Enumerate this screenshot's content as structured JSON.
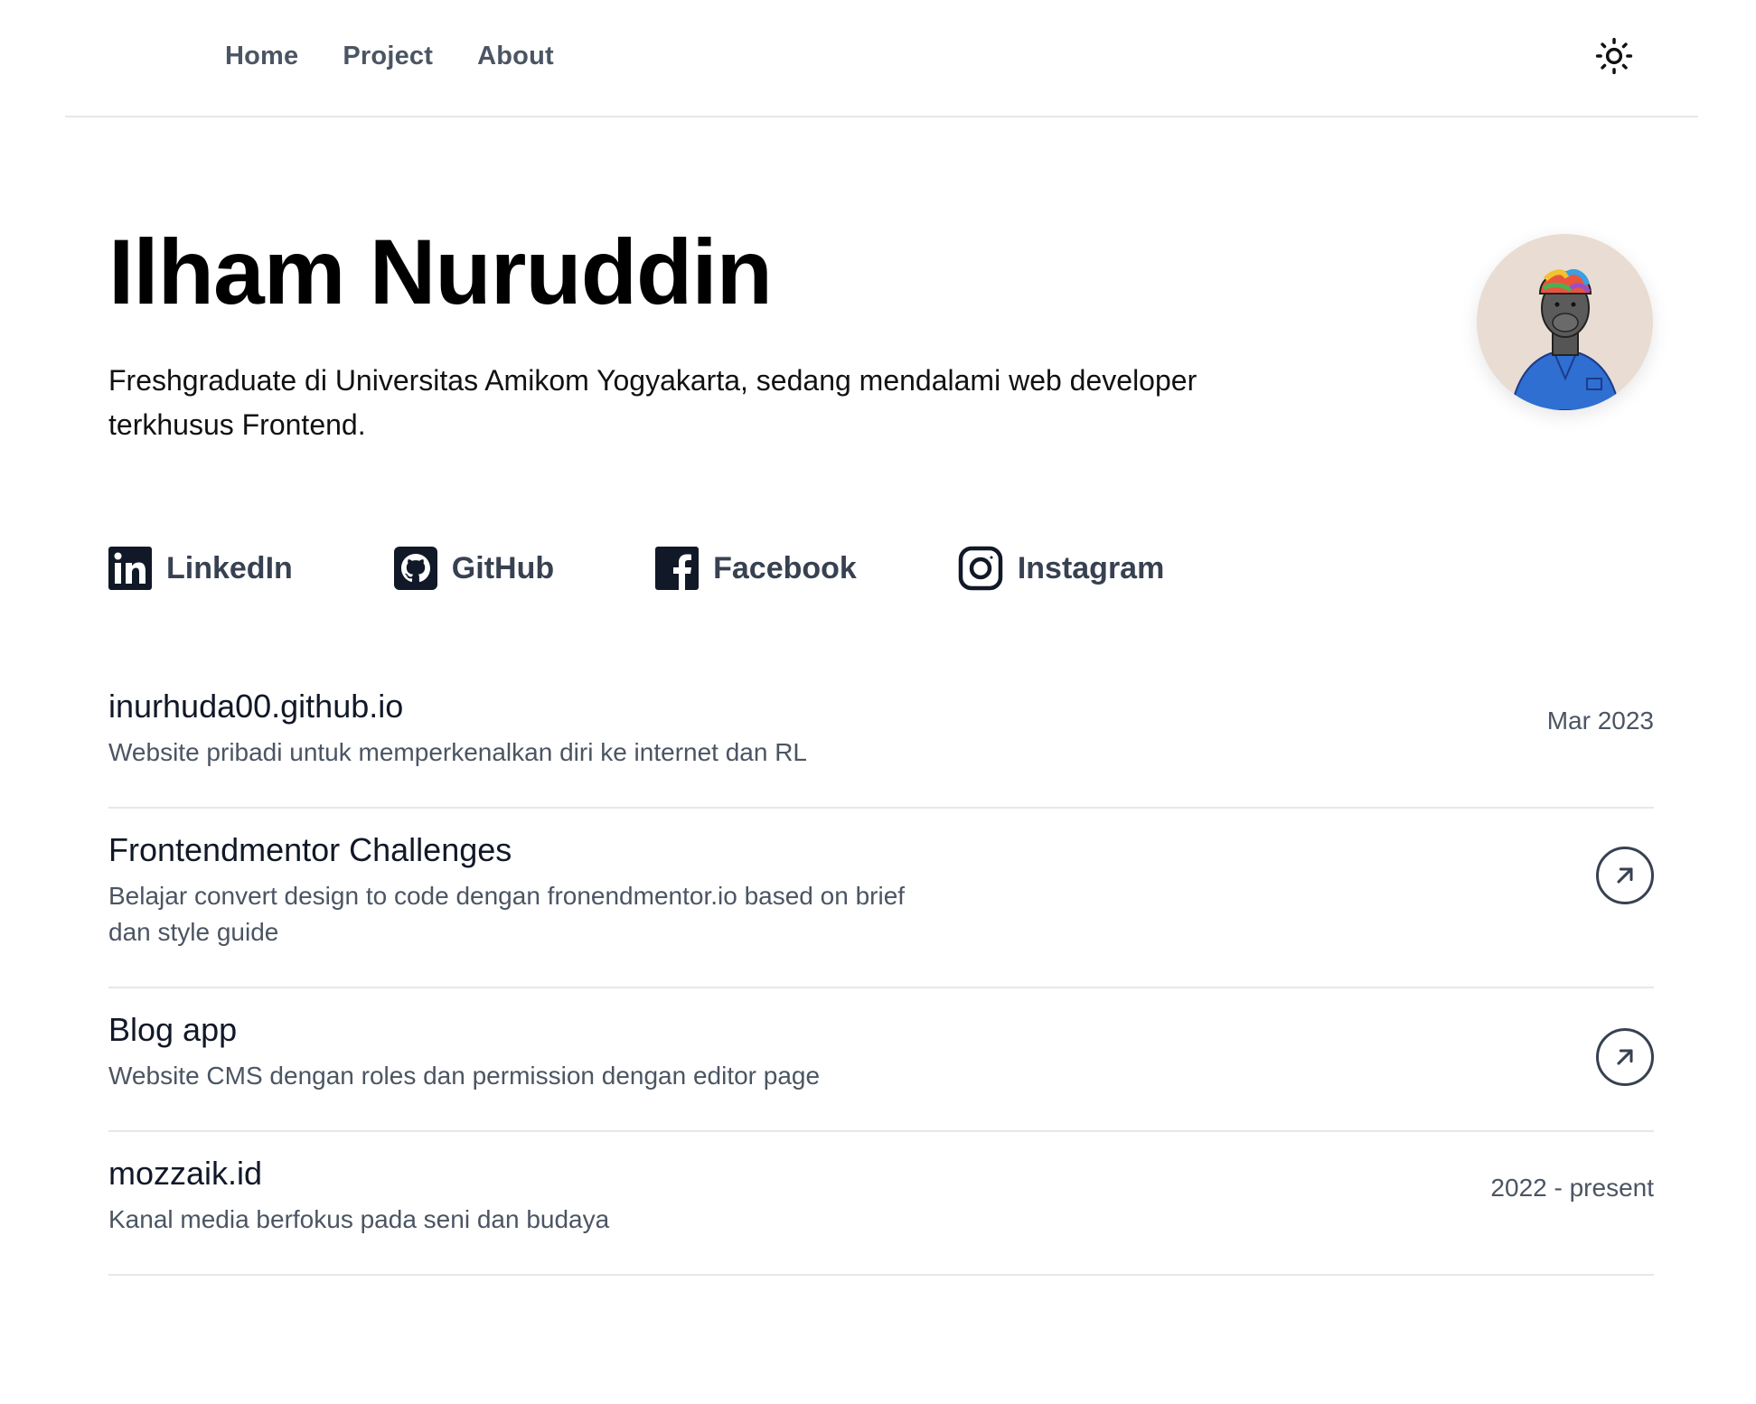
{
  "nav": {
    "links": [
      {
        "label": "Home"
      },
      {
        "label": "Project"
      },
      {
        "label": "About"
      }
    ],
    "theme_toggle_icon": "sun-icon"
  },
  "hero": {
    "name": "Ilham Nuruddin",
    "bio": "Freshgraduate di Universitas Amikom Yogyakarta, sedang mendalami web developer terkhusus Frontend.",
    "avatar_icon": "avatar-illustration"
  },
  "socials": [
    {
      "label": "LinkedIn",
      "icon": "linkedin-icon"
    },
    {
      "label": "GitHub",
      "icon": "github-icon"
    },
    {
      "label": "Facebook",
      "icon": "facebook-icon"
    },
    {
      "label": "Instagram",
      "icon": "instagram-icon"
    }
  ],
  "projects": [
    {
      "title": "inurhuda00.github.io",
      "description": "Website pribadi untuk memperkenalkan diri ke internet dan RL",
      "meta": "Mar 2023"
    },
    {
      "title": "Frontendmentor Challenges",
      "description": "Belajar convert design to code dengan fronendmentor.io based on brief dan style guide",
      "link_icon": "arrow-up-right-icon"
    },
    {
      "title": "Blog app",
      "description": "Website CMS dengan roles dan permission dengan editor page",
      "link_icon": "arrow-up-right-icon"
    },
    {
      "title": "mozzaik.id",
      "description": "Kanal media berfokus pada seni dan budaya",
      "meta": "2022 - present"
    }
  ],
  "colors": {
    "text": "#111827",
    "muted": "#4b5563",
    "border": "#e5e7eb",
    "avatar_bg": "#e8dcd3",
    "shirt": "#2f6fd1"
  }
}
